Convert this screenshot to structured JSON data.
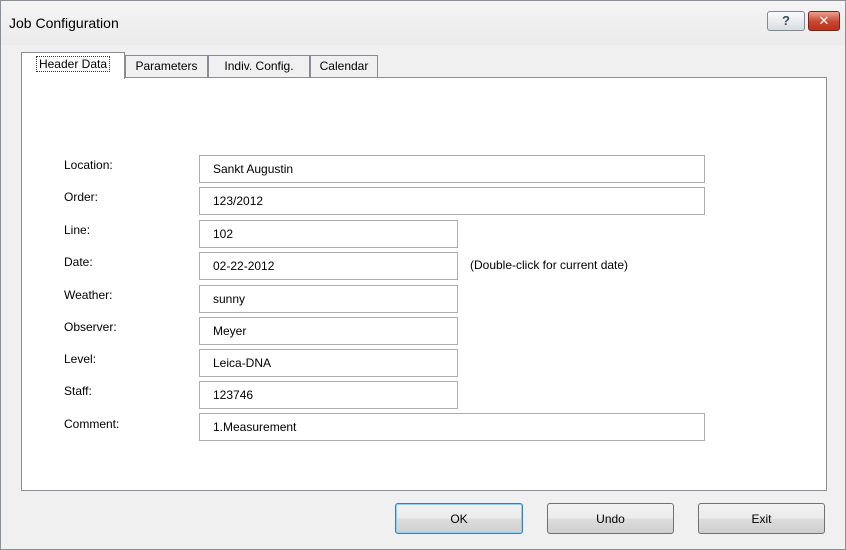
{
  "window": {
    "title": "Job Configuration",
    "help_label": "?",
    "close_label": "✕"
  },
  "tabs": [
    {
      "label": "Header Data",
      "active": true
    },
    {
      "label": "Parameters",
      "active": false
    },
    {
      "label": "Indiv. Config.",
      "active": false
    },
    {
      "label": "Calendar",
      "active": false
    }
  ],
  "fields": {
    "location": {
      "label": "Location:",
      "value": "Sankt Augustin"
    },
    "order": {
      "label": "Order:",
      "value": "123/2012"
    },
    "line": {
      "label": "Line:",
      "value": "102"
    },
    "date": {
      "label": "Date:",
      "value": "02-22-2012",
      "hint": "(Double-click for current date)"
    },
    "weather": {
      "label": "Weather:",
      "value": "sunny"
    },
    "observer": {
      "label": "Observer:",
      "value": "Meyer"
    },
    "level": {
      "label": "Level:",
      "value": "Leica-DNA"
    },
    "staff": {
      "label": "Staff:",
      "value": "123746"
    },
    "comment": {
      "label": "Comment:",
      "value": "1.Measurement"
    }
  },
  "buttons": {
    "ok": "OK",
    "undo": "Undo",
    "exit": "Exit"
  }
}
